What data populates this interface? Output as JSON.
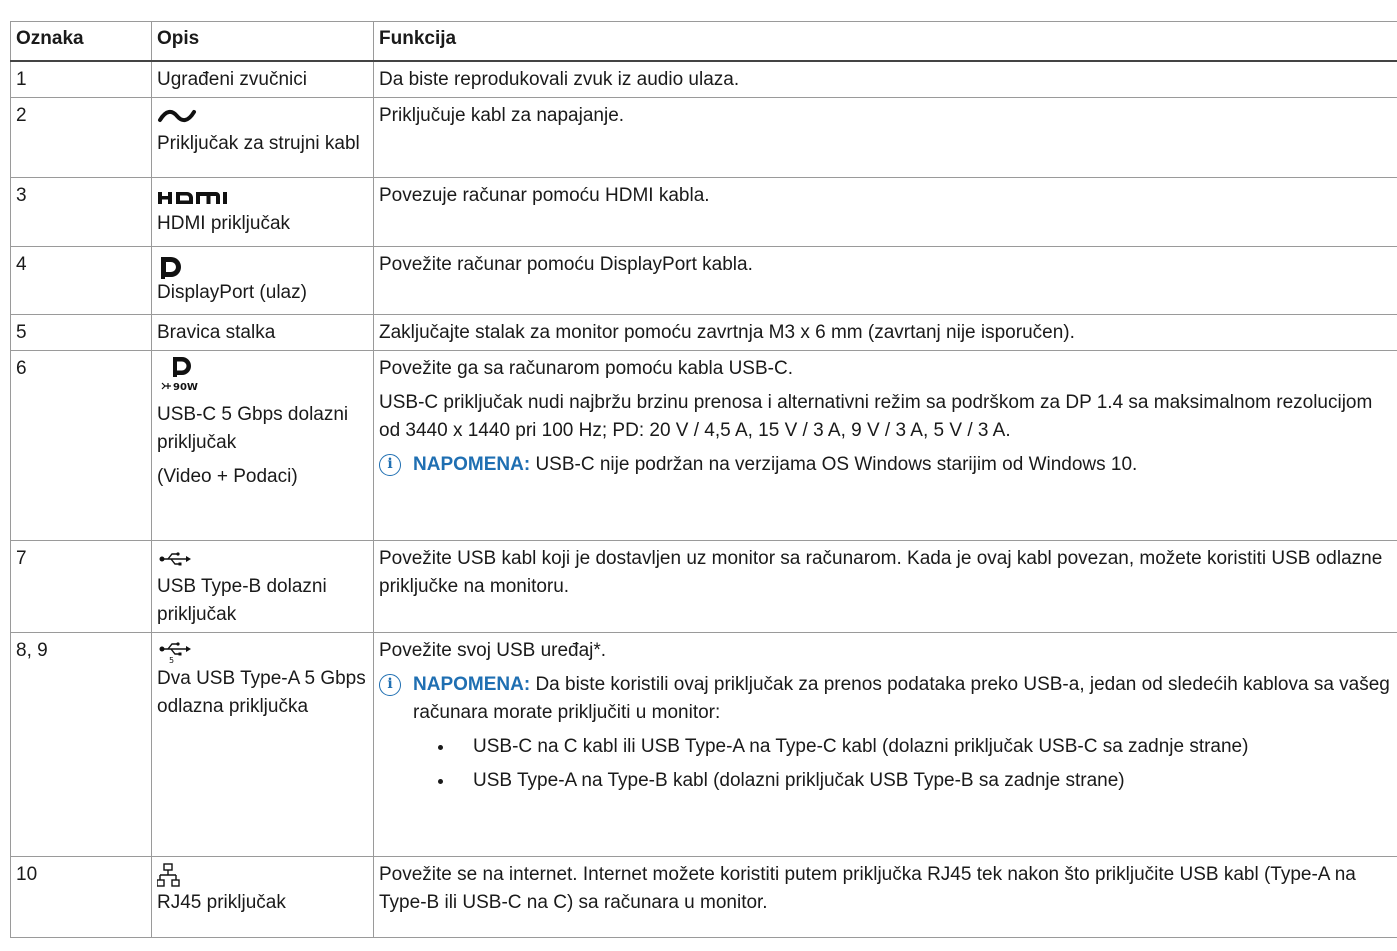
{
  "table": {
    "headers": [
      "Oznaka",
      "Opis",
      "Funkcija"
    ],
    "rows": [
      {
        "label": "1",
        "icon": "",
        "description": "Ugrađeni zvučnici",
        "functions": [
          "Da biste reprodukovali zvuk iz audio ulaza."
        ]
      },
      {
        "label": "2",
        "icon": "power-ac-icon",
        "description": "Priključak za strujni kabl",
        "functions": [
          "Priključuje kabl za napajanje."
        ]
      },
      {
        "label": "3",
        "icon": "hdmi-icon",
        "description": "HDMI priključak",
        "functions": [
          "Povezuje računar pomoću HDMI kabla."
        ]
      },
      {
        "label": "4",
        "icon": "displayport-icon",
        "description": "DisplayPort (ulaz)",
        "functions": [
          "Povežite računar pomoću DisplayPort kabla."
        ]
      },
      {
        "label": "5",
        "icon": "",
        "description": "Bravica stalka",
        "functions": [
          "Zaključajte stalak za monitor pomoću zavrtnja M3 x 6 mm (zavrtanj nije isporučen)."
        ]
      },
      {
        "label": "6",
        "icon": "usbc-dp-90w-icon",
        "icon_text": "90W",
        "description": "USB-C 5 Gbps dolazni priključak",
        "description_extra": "(Video + Podaci)",
        "functions": [
          "Povežite ga sa računarom pomoću kabla USB-C.",
          "USB-C priključak nudi najbržu brzinu prenosa i alternativni režim sa podrškom za DP 1.4 sa maksimalnom rezolucijom od 3440 x 1440 pri 100 Hz; PD: 20 V / 4,5 A, 15 V / 3 A, 9 V / 3 A, 5 V / 3 A."
        ],
        "note": {
          "label": "NAPOMENA:",
          "text": "USB-C nije podržan na verzijama OS Windows starijim od Windows 10."
        }
      },
      {
        "label": "7",
        "icon": "usb-icon",
        "description": "USB Type-B dolazni priključak",
        "functions": [
          "Povežite USB kabl koji je dostavljen uz monitor sa računarom. Kada je ovaj kabl povezan, možete koristiti USB odlazne priključke na monitoru."
        ]
      },
      {
        "label": "8, 9",
        "icon": "usb-5gbps-icon",
        "icon_text": "5",
        "description": "Dva USB Type-A 5 Gbps odlazna priključka",
        "functions": [
          "Povežite svoj USB uređaj*."
        ],
        "note": {
          "label": "NAPOMENA:",
          "text": "Da biste koristili ovaj priključak za prenos podataka preko USB-a, jedan od sledećih kablova sa vašeg računara morate priključiti u monitor:"
        },
        "bullets": [
          "USB-C na C kabl ili USB Type-A na Type-C kabl (dolazni priključak USB-C sa zadnje strane)",
          "USB Type-A na Type-B kabl (dolazni priključak USB Type-B sa zadnje strane)"
        ]
      },
      {
        "label": "10",
        "icon": "network-rj45-icon",
        "description": "RJ45 priključak",
        "functions": [
          "Povežite se na internet. Internet možete koristiti putem priključka RJ45 tek nakon što priključite USB kabl (Type-A na Type-B ili USB-C na C) sa računara u monitor."
        ]
      }
    ]
  },
  "colors": {
    "note_accent": "#1f6fb2",
    "border": "#9a9a9a",
    "text": "#1a1a1a"
  }
}
